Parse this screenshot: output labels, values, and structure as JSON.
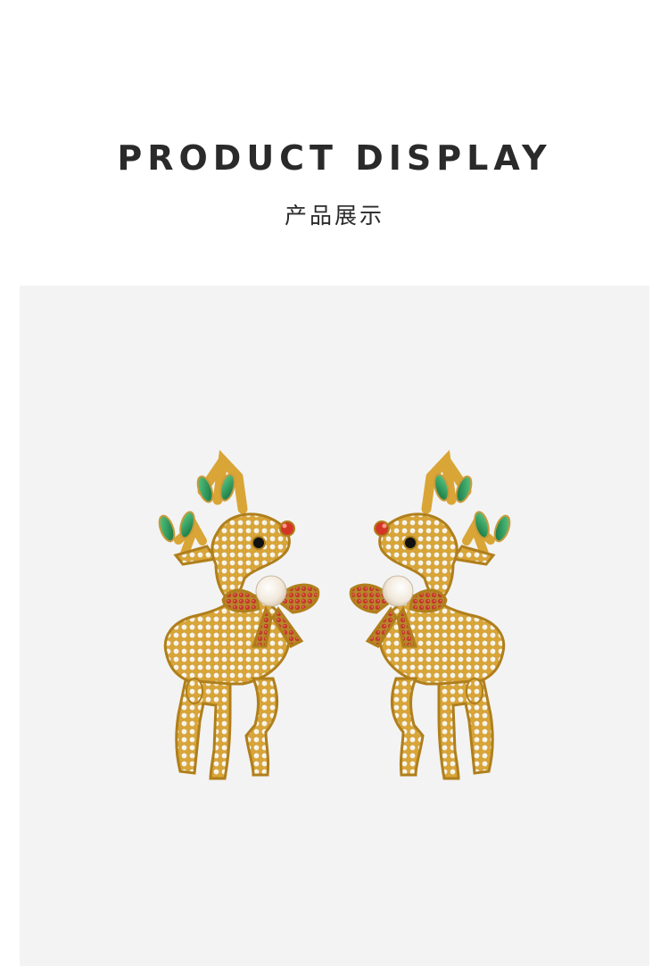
{
  "header": {
    "title_en": "PRODUCT DISPLAY",
    "title_cn": "产品展示"
  },
  "photo": {
    "subject": "reindeer-earrings",
    "background_color": "#f3f3f3",
    "colors": {
      "gold": "#d9a536",
      "gold_dark": "#b07f1c",
      "stone": "#f7f1e1",
      "leaf": "#1f8a4c",
      "ruby": "#c43a2a",
      "pearl": "#f6f0e6",
      "eye": "#111111"
    }
  }
}
